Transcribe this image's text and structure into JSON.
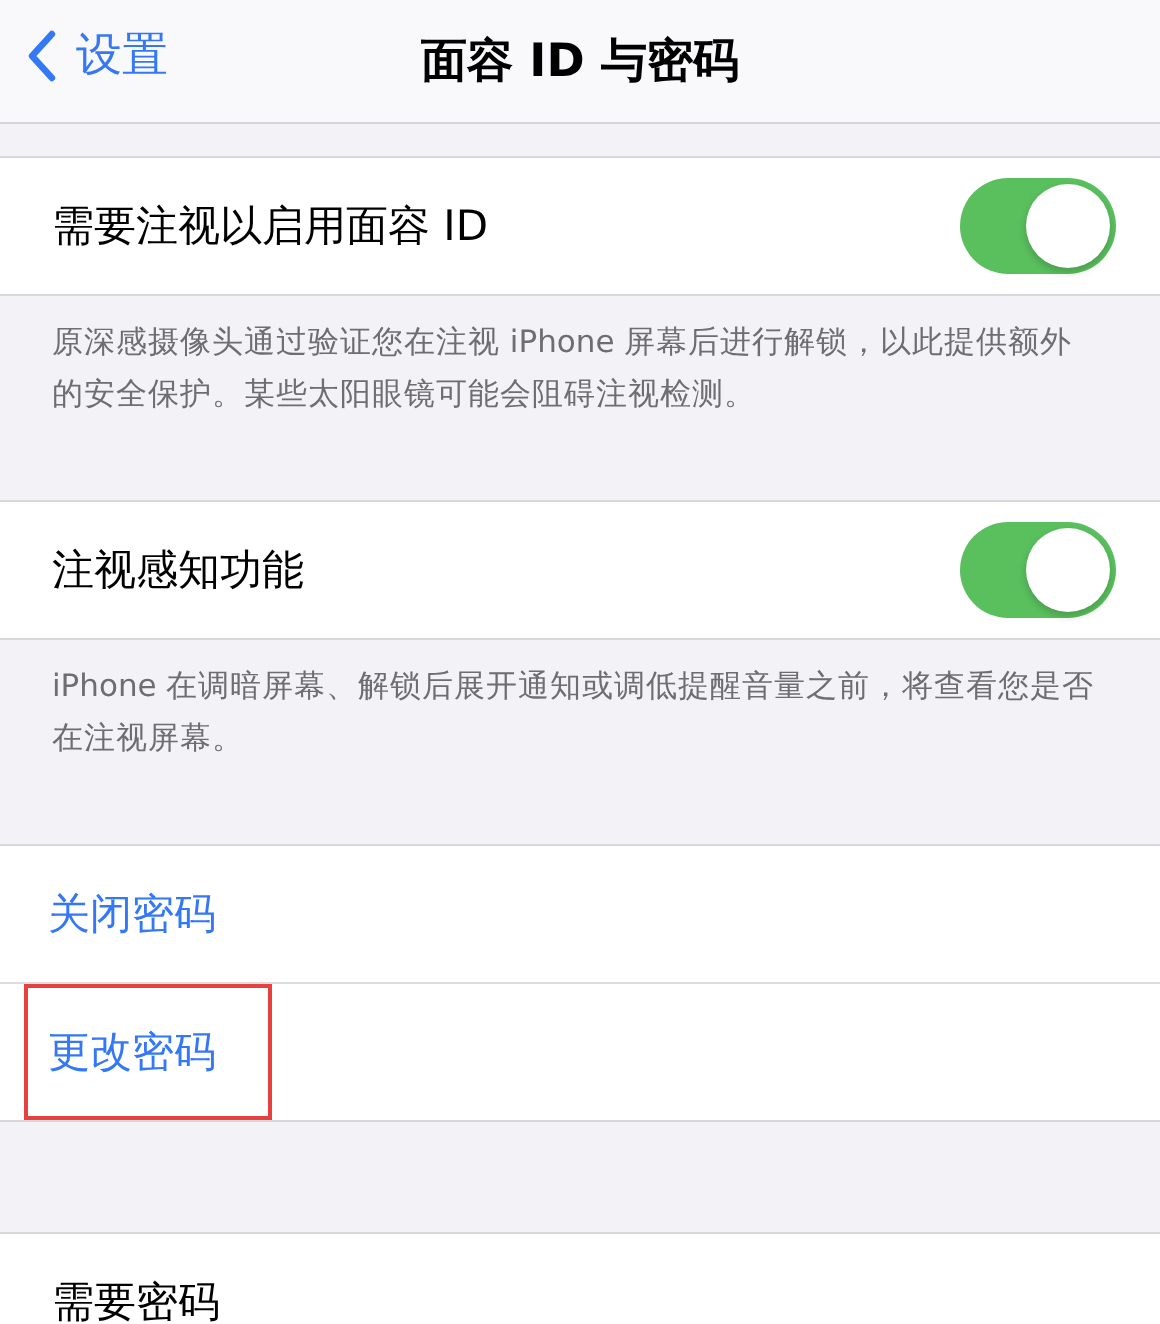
{
  "nav": {
    "back": "设置",
    "title": "面容 ID 与密码"
  },
  "sections": [
    {
      "rows": [
        {
          "kind": "toggle",
          "label": "需要注视以启用面容 ID",
          "on": true
        }
      ],
      "footer": "原深感摄像头通过验证您在注视 iPhone 屏幕后进行解锁，以此提供额外的安全保护。某些太阳眼镜可能会阻碍注视检测。"
    },
    {
      "rows": [
        {
          "kind": "toggle",
          "label": "注视感知功能",
          "on": true
        }
      ],
      "footer": "iPhone 在调暗屏幕、解锁后展开通知或调低提醒音量之前，将查看您是否在注视屏幕。"
    },
    {
      "rows": [
        {
          "kind": "link",
          "label": "关闭密码",
          "highlighted": false
        },
        {
          "kind": "link",
          "label": "更改密码",
          "highlighted": true
        }
      ]
    },
    {
      "rows": [
        {
          "kind": "plain",
          "label": "需要密码"
        }
      ]
    }
  ]
}
